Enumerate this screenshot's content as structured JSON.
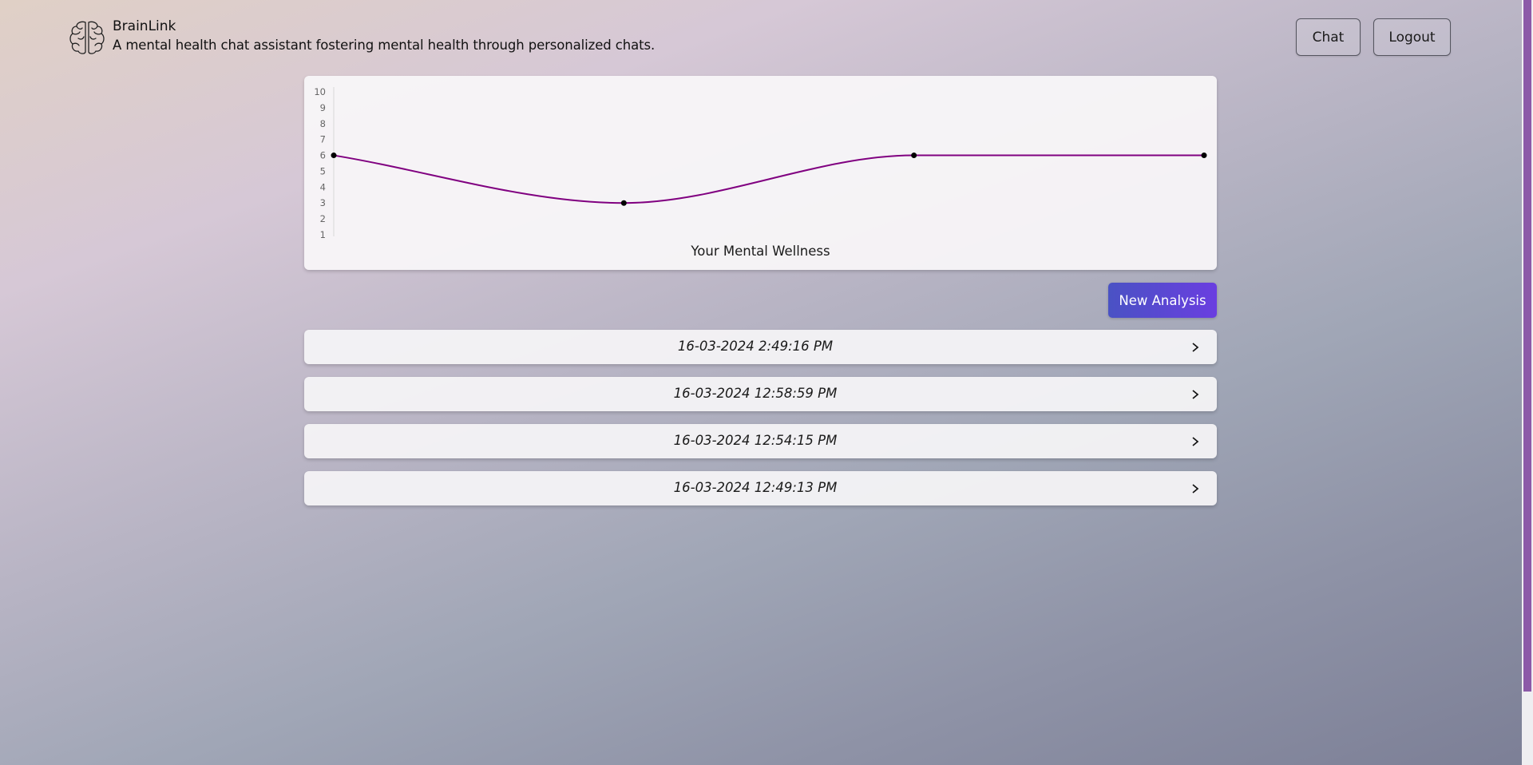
{
  "header": {
    "brand_icon": "brain-icon",
    "title": "BrainLink",
    "subtitle": "A mental health chat assistant fostering mental health through personalized chats.",
    "nav": {
      "chat_label": "Chat",
      "logout_label": "Logout"
    }
  },
  "chart_data": {
    "type": "line",
    "title": "Your Mental Wellness",
    "x": [
      1,
      2,
      3,
      4
    ],
    "series": [
      {
        "values": [
          6,
          3,
          6,
          6
        ]
      }
    ],
    "y_ticks": [
      "1",
      "2",
      "3",
      "4",
      "5",
      "6",
      "7",
      "8",
      "9",
      "10"
    ],
    "ylim": [
      1,
      10
    ],
    "line_color": "#800080",
    "point_color": "#000000",
    "grid": false
  },
  "actions": {
    "new_analysis_label": "New Analysis"
  },
  "sessions": [
    {
      "date": "16-03-2024 2:49:16 PM",
      "icon": "chevron-right-icon"
    },
    {
      "date": "16-03-2024 12:58:59 PM",
      "icon": "chevron-right-icon"
    },
    {
      "date": "16-03-2024 12:54:15 PM",
      "icon": "chevron-right-icon"
    },
    {
      "date": "16-03-2024 12:49:13 PM",
      "icon": "chevron-right-icon"
    }
  ],
  "colors": {
    "accent_start": "#4a52c4",
    "accent_end": "#6a3ee0",
    "scrollbar": "#8c5aa8"
  }
}
